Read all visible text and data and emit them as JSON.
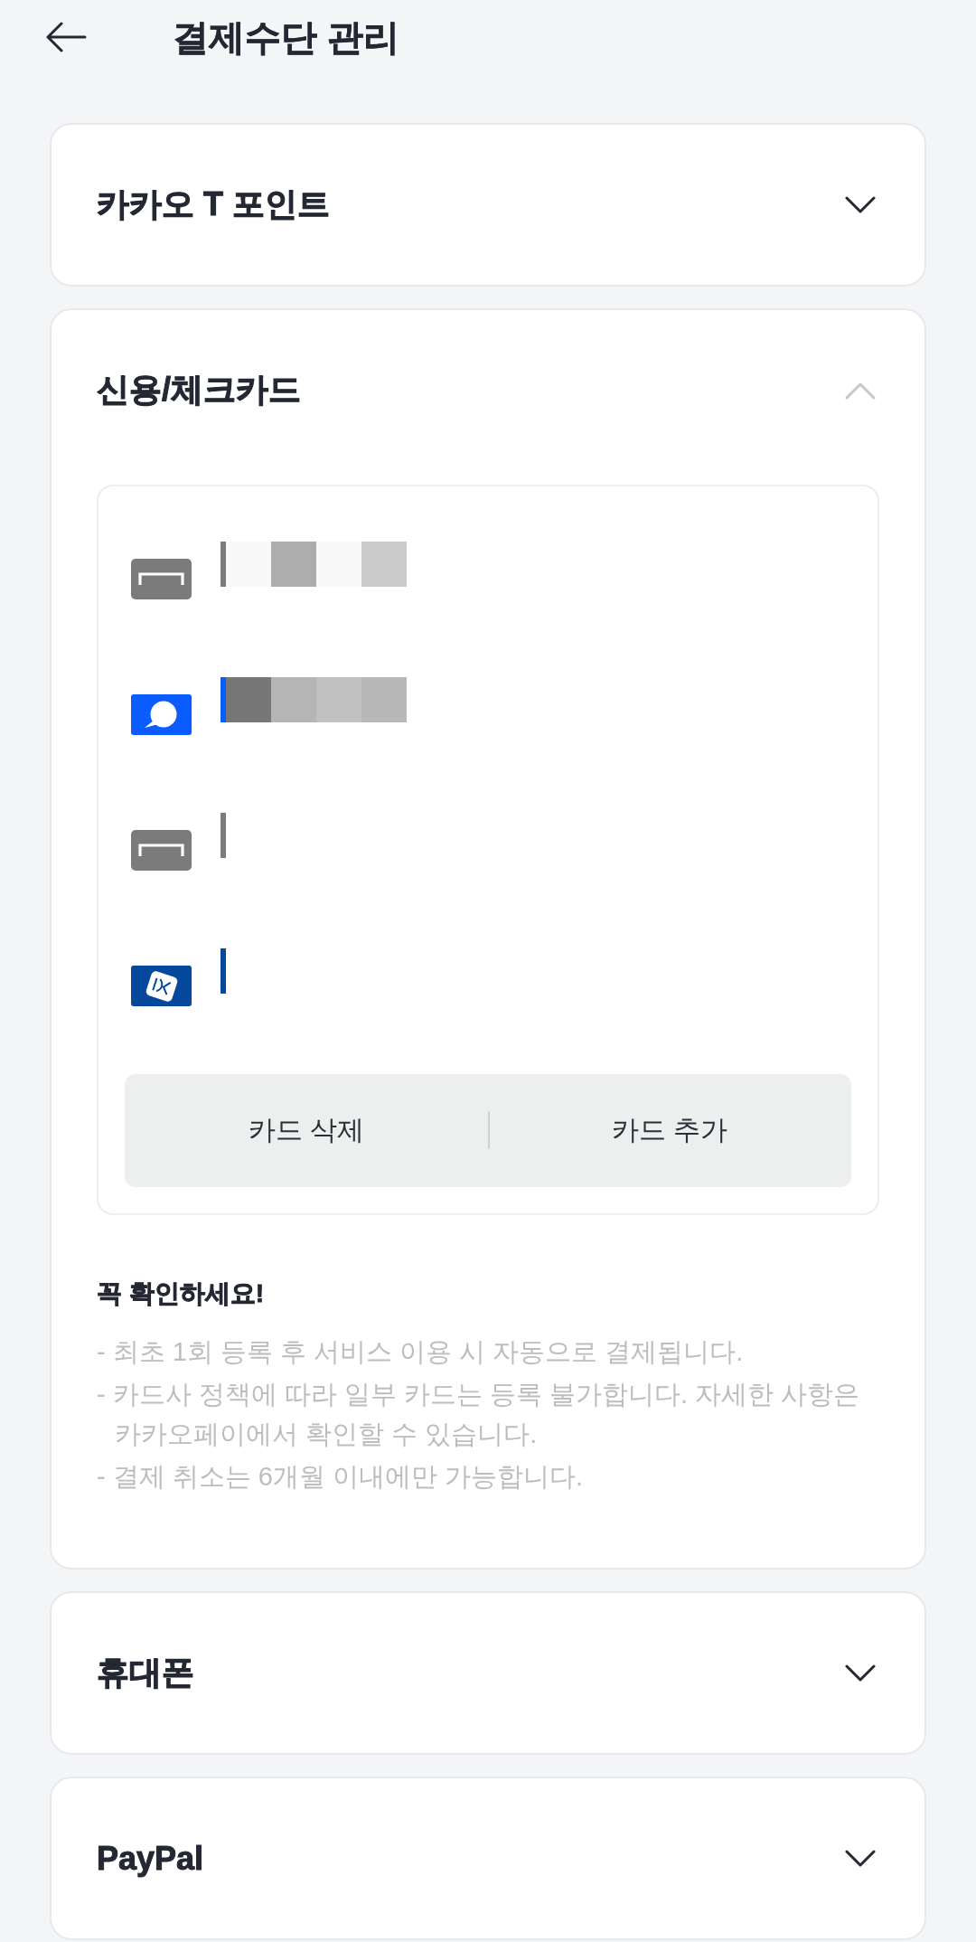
{
  "header": {
    "title": "결제수단 관리"
  },
  "sections": [
    {
      "title": "카카오 T 포인트",
      "expanded": false
    },
    {
      "title": "신용/체크카드",
      "expanded": true,
      "cards": [
        {
          "kind": "generic",
          "color": "#7b7b7b",
          "mosaic": [
            {
              "color": "#f9f9f9"
            },
            {
              "color": "#adadad"
            },
            {
              "color": "#f9f9f9"
            },
            {
              "color": "#cbcbcb"
            }
          ]
        },
        {
          "kind": "bubble",
          "color": "#0a5cff",
          "mosaic": [
            {
              "color": "#777777"
            },
            {
              "color": "#b5b5b5"
            },
            {
              "color": "#c1c1c1"
            },
            {
              "color": "#b8b8b8"
            }
          ]
        },
        {
          "kind": "generic",
          "color": "#7b7b7b"
        },
        {
          "kind": "emblem",
          "color": "#06489c"
        }
      ],
      "buttons": [
        "카드 삭제",
        "카드 추가"
      ],
      "notice": {
        "title": "꼭 확인하세요!",
        "items": [
          "- 최초 1회 등록 후 서비스 이용 시 자동으로 결제됩니다.",
          "- 카드사 정책에 따라 일부 카드는 등록 불가합니다. 자세한 사항은 카카오페이에서 확인할 수 있습니다.",
          "- 결제 취소는 6개월 이내에만 가능합니다."
        ]
      }
    },
    {
      "title": "휴대폰",
      "expanded": false
    },
    {
      "title": "PayPal",
      "expanded": false
    }
  ]
}
